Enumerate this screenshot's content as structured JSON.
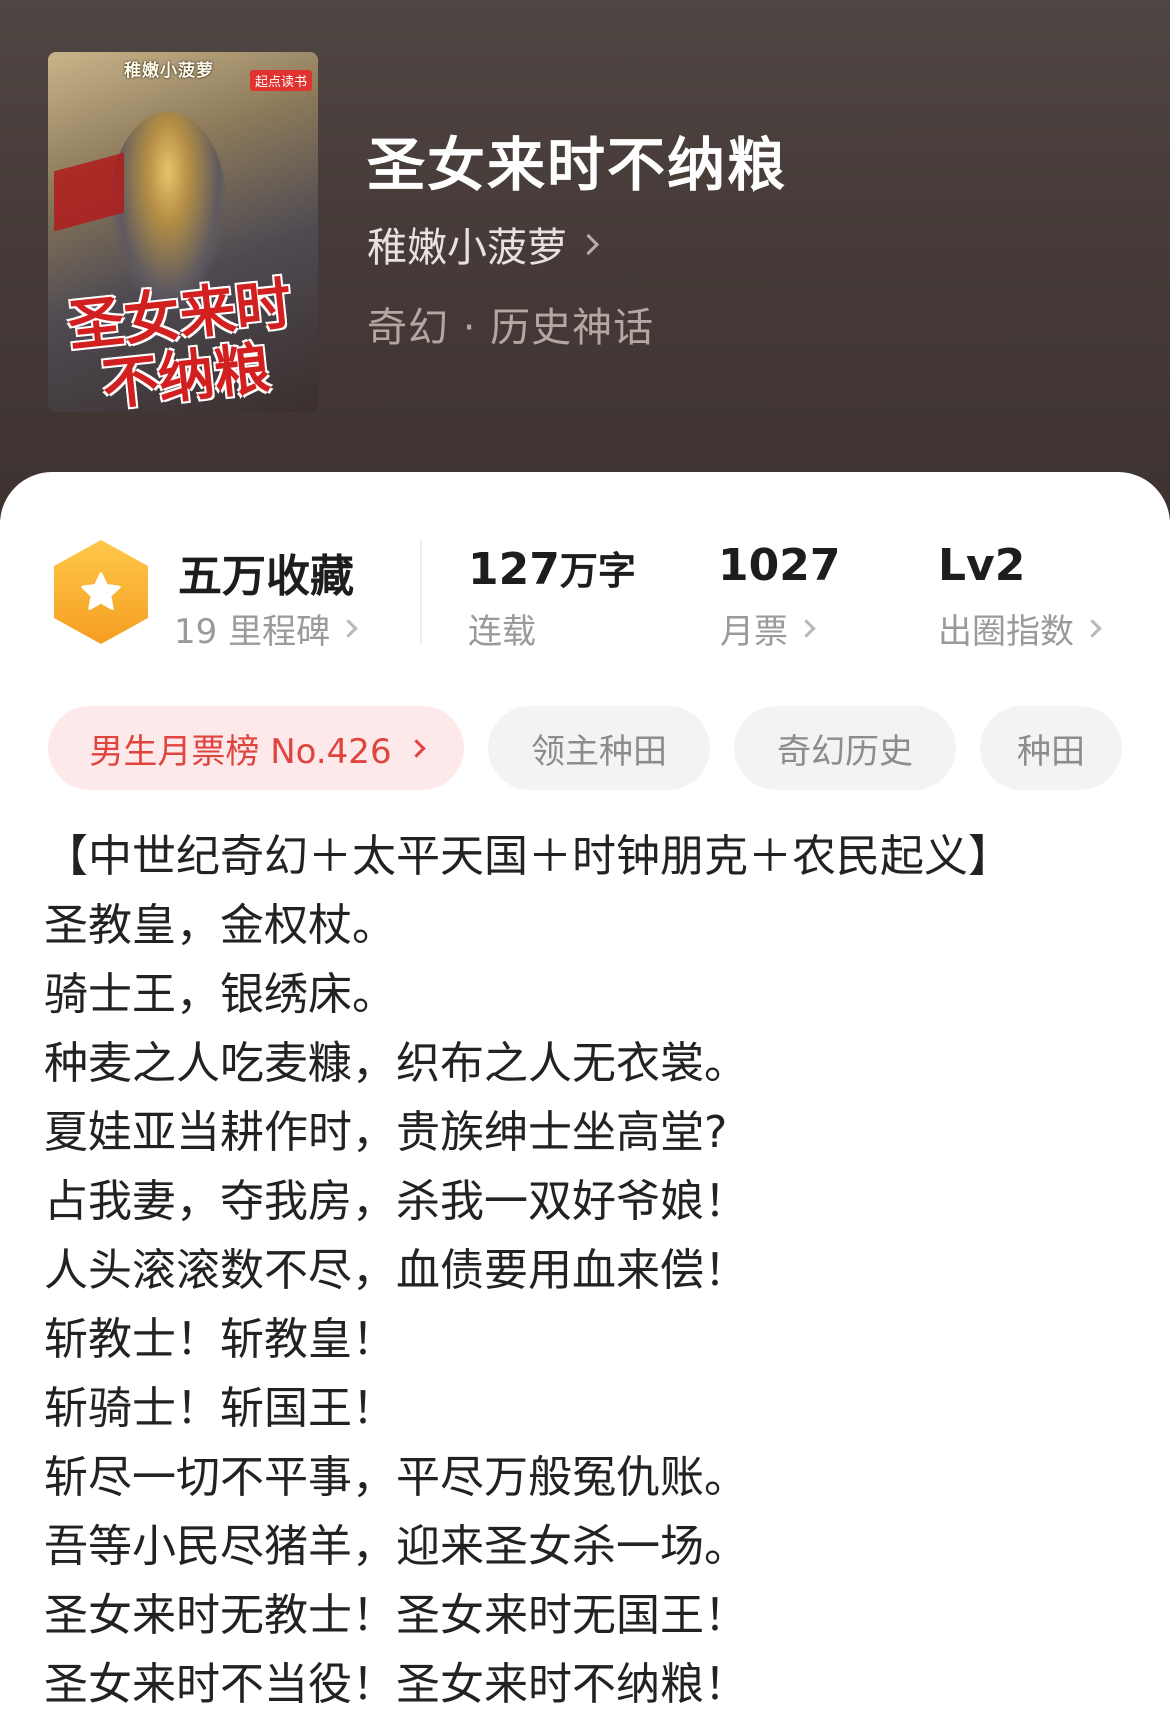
{
  "book": {
    "title": "圣女来时不纳粮",
    "author": "稚嫩小菠萝",
    "category": "奇幻 · 历史神话",
    "cover": {
      "author_text": "稚嫩小菠萝",
      "brand_text": "起点读书",
      "title_text": "圣女来时不纳粮"
    }
  },
  "stats": {
    "collect": {
      "main": "五万收藏",
      "sub": "19 里程碑",
      "icon": "star-icon"
    },
    "words": {
      "number": "127",
      "unit": "万字",
      "sub": "连载"
    },
    "monthly": {
      "main": "1027",
      "sub": "月票"
    },
    "level": {
      "main": "Lv2",
      "sub": "出圈指数"
    }
  },
  "tags": {
    "rank": "男生月票榜 No.426",
    "items": [
      "领主种田",
      "奇幻历史",
      "种田"
    ]
  },
  "synopsis": [
    "【中世纪奇幻＋太平天国＋时钟朋克＋农民起义】",
    "圣教皇，金权杖。",
    "骑士王，银绣床。",
    "种麦之人吃麦糠，织布之人无衣裳。",
    "夏娃亚当耕作时，贵族绅士坐高堂?",
    "占我妻，夺我房，杀我一双好爷娘！",
    "人头滚滚数不尽，血债要用血来偿！",
    "斩教士！斩教皇！",
    "斩骑士！斩国王！",
    "斩尽一切不平事，平尽万般冤仇账。",
    "吾等小民尽猪羊，迎来圣女杀一场。",
    "圣女来时无教士！圣女来时无国王！",
    "圣女来时不当役！圣女来时不纳粮！"
  ],
  "colors": {
    "header_bg": "#463b38",
    "accent_red": "#e0443e",
    "rank_bg": "#fde9e9",
    "hex_orange": "#f59e21"
  }
}
